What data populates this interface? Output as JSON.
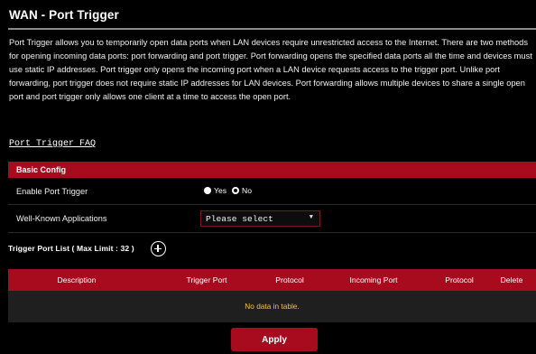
{
  "page": {
    "title": "WAN - Port Trigger",
    "description": "Port Trigger allows you to temporarily open data ports when LAN devices require unrestricted access to the Internet. There are two methods for opening incoming data ports: port forwarding and port trigger. Port forwarding opens the specified data ports all the time and devices must use static IP addresses. Port trigger only opens the incoming port when a LAN device requests access to the trigger port. Unlike port forwarding, port trigger does not require static IP addresses for LAN devices. Port forwarding allows multiple devices to share a single open port and port trigger only allows one client at a time to access the open port.",
    "faq_link": "Port Trigger FAQ"
  },
  "basic_config": {
    "header": "Basic Config",
    "enable_label": "Enable Port Trigger",
    "enable_options": [
      {
        "label": "Yes",
        "selected": false
      },
      {
        "label": "No",
        "selected": true
      }
    ],
    "apps_label": "Well-Known Applications",
    "apps_select_value": "Please select"
  },
  "trigger_list": {
    "title": "Trigger Port List ( Max Limit : 32 )",
    "columns": [
      "Description",
      "Trigger Port",
      "Protocol",
      "Incoming Port",
      "Protocol",
      "Delete"
    ],
    "empty_text": "No data in table."
  },
  "actions": {
    "apply_label": "Apply"
  },
  "colors": {
    "accent": "#a90b1e",
    "empty_text": "#f5c242",
    "background": "#000000"
  }
}
